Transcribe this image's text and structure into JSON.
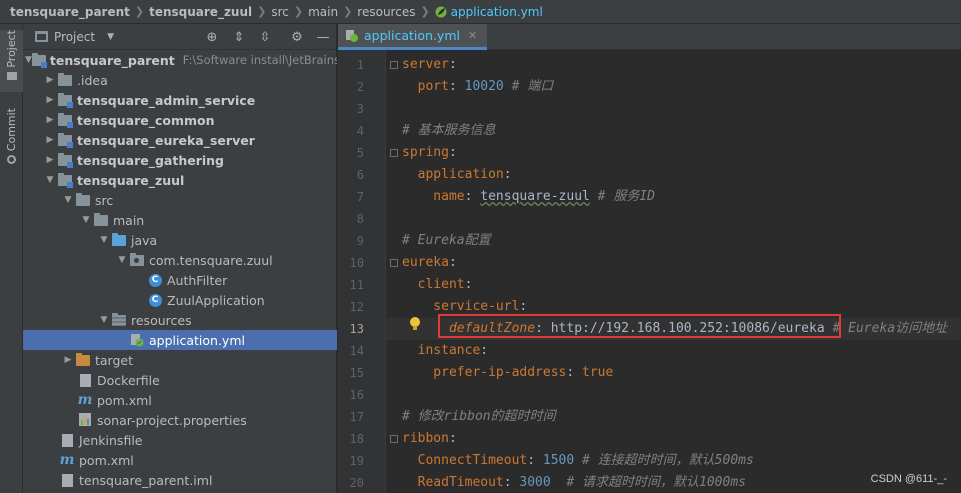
{
  "breadcrumb": [
    "tensquare_parent",
    "tensquare_zuul",
    "src",
    "main",
    "resources",
    "application.yml"
  ],
  "tool_strip": {
    "project_label": "Project",
    "commit_label": "Commit"
  },
  "project_panel": {
    "title": "Project",
    "tree": [
      {
        "label": "tensquare_parent",
        "path": "F:\\Software install\\JetBrains\\"
      },
      {
        "label": ".idea"
      },
      {
        "label": "tensquare_admin_service"
      },
      {
        "label": "tensquare_common"
      },
      {
        "label": "tensquare_eureka_server"
      },
      {
        "label": "tensquare_gathering"
      },
      {
        "label": "tensquare_zuul"
      },
      {
        "label": "src"
      },
      {
        "label": "main"
      },
      {
        "label": "java"
      },
      {
        "label": "com.tensquare.zuul"
      },
      {
        "label": "AuthFilter"
      },
      {
        "label": "ZuulApplication"
      },
      {
        "label": "resources"
      },
      {
        "label": "application.yml"
      },
      {
        "label": "target"
      },
      {
        "label": "Dockerfile"
      },
      {
        "label": "pom.xml"
      },
      {
        "label": "sonar-project.properties"
      },
      {
        "label": "Jenkinsfile"
      },
      {
        "label": "pom.xml"
      },
      {
        "label": "tensquare_parent.iml"
      }
    ]
  },
  "editor": {
    "tab_label": "application.yml",
    "lines": [
      {
        "num": "1",
        "key": "server",
        "sep": ":",
        "val": "",
        "comment": ""
      },
      {
        "num": "2",
        "key": "  port",
        "sep": ": ",
        "val": "10020",
        "comment": " # 端口"
      },
      {
        "num": "3",
        "key": "",
        "sep": "",
        "val": "",
        "comment": ""
      },
      {
        "num": "4",
        "key": "",
        "sep": "",
        "val": "",
        "comment": "# 基本服务信息"
      },
      {
        "num": "5",
        "key": "spring",
        "sep": ":",
        "val": "",
        "comment": ""
      },
      {
        "num": "6",
        "key": "  application",
        "sep": ":",
        "val": "",
        "comment": ""
      },
      {
        "num": "7",
        "key": "    name",
        "sep": ": ",
        "val": "tensquare-zuul",
        "comment": " # 服务ID"
      },
      {
        "num": "8",
        "key": "",
        "sep": "",
        "val": "",
        "comment": ""
      },
      {
        "num": "9",
        "key": "",
        "sep": "",
        "val": "",
        "comment": "# Eureka配置"
      },
      {
        "num": "10",
        "key": "eureka",
        "sep": ":",
        "val": "",
        "comment": ""
      },
      {
        "num": "11",
        "key": "  client",
        "sep": ":",
        "val": "",
        "comment": ""
      },
      {
        "num": "12",
        "key": "    service-url",
        "sep": ":",
        "val": "",
        "comment": ""
      },
      {
        "num": "13",
        "key": "      defaultZone",
        "sep": ": ",
        "val": "http://192.168.100.252:10086/eureka",
        "comment": " # Eureka访问地址"
      },
      {
        "num": "14",
        "key": "  instance",
        "sep": ":",
        "val": "",
        "comment": ""
      },
      {
        "num": "15",
        "key": "    prefer-ip-address",
        "sep": ": ",
        "val": "true",
        "comment": ""
      },
      {
        "num": "16",
        "key": "",
        "sep": "",
        "val": "",
        "comment": ""
      },
      {
        "num": "17",
        "key": "",
        "sep": "",
        "val": "",
        "comment": "# 修改ribbon的超时时间"
      },
      {
        "num": "18",
        "key": "ribbon",
        "sep": ":",
        "val": "",
        "comment": ""
      },
      {
        "num": "19",
        "key": "  ConnectTimeout",
        "sep": ": ",
        "val": "1500",
        "comment": " # 连接超时时间，默认500ms"
      },
      {
        "num": "20",
        "key": "  ReadTimeout",
        "sep": ": ",
        "val": "3000",
        "comment": "  # 请求超时时间，默认1000ms"
      }
    ]
  },
  "watermark": "CSDN @611-_-",
  "colors": {
    "keyword": "#cc7832",
    "number": "#6897bb",
    "comment": "#808080",
    "selection": "#4b6eaf",
    "highlight_box": "#e03a3a"
  }
}
